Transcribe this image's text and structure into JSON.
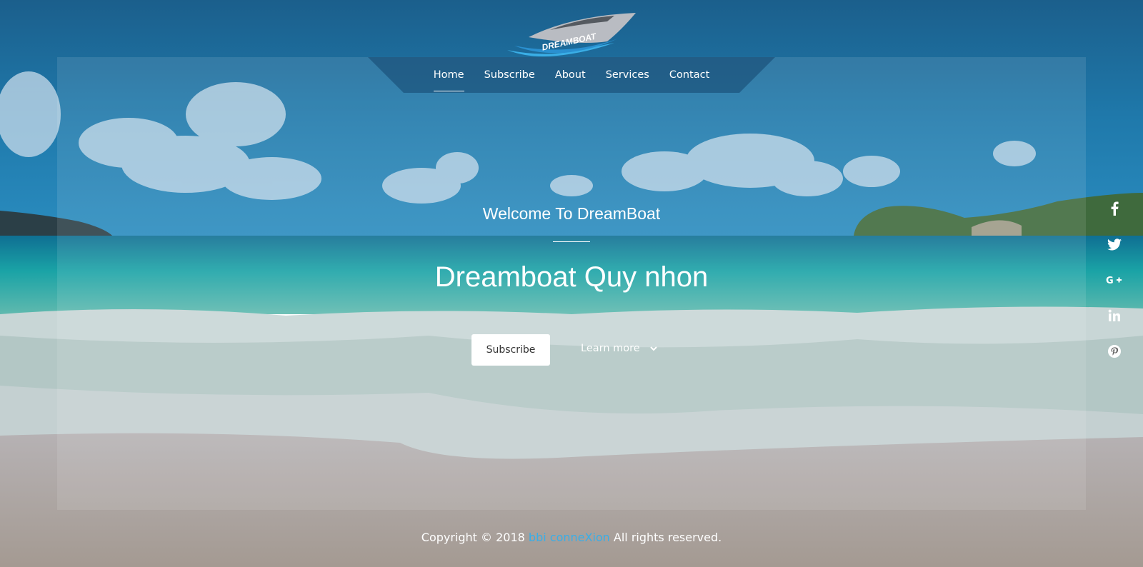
{
  "brand": {
    "logo_text": "DREAMBOAT"
  },
  "nav": {
    "items": [
      {
        "label": "Home",
        "active": true
      },
      {
        "label": "Subscribe"
      },
      {
        "label": "About"
      },
      {
        "label": "Services"
      },
      {
        "label": "Contact"
      }
    ]
  },
  "hero": {
    "welcome": "Welcome To DreamBoat",
    "title": "Dreamboat Quy nhon",
    "subscribe_label": "Subscribe",
    "learn_more_label": "Learn more"
  },
  "social": {
    "items": [
      {
        "name": "facebook-icon"
      },
      {
        "name": "twitter-icon"
      },
      {
        "name": "google-plus-icon"
      },
      {
        "name": "linkedin-icon"
      },
      {
        "name": "pinterest-icon"
      }
    ]
  },
  "footer": {
    "prefix": "Copyright © 2018 ",
    "link": "bbi conneXion",
    "suffix": " All rights reserved."
  },
  "colors": {
    "link": "#38aee8",
    "sky": "#1c6a9c",
    "sea": "#1aa3a6",
    "sand": "#b8aca6"
  }
}
